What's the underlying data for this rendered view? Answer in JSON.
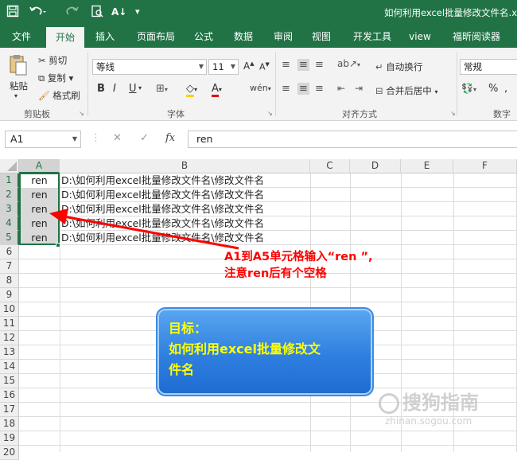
{
  "window": {
    "title": "如何利用excel批量修改文件名.x"
  },
  "ribbon_tabs": [
    "文件",
    "开始",
    "插入",
    "页面布局",
    "公式",
    "数据",
    "审阅",
    "视图",
    "开发工具",
    "view",
    "福昕阅读器"
  ],
  "active_tab": "开始",
  "clipboard": {
    "paste": "粘贴",
    "cut": "剪切",
    "copy": "复制",
    "format_painter": "格式刷",
    "group_label": "剪贴板"
  },
  "font": {
    "font_name": "等线",
    "font_size": "11",
    "group_label": "字体",
    "bold": "B",
    "italic": "I",
    "underline": "U"
  },
  "alignment": {
    "wrap_text": "自动换行",
    "merge_center": "合并后居中",
    "group_label": "对齐方式"
  },
  "number": {
    "format": "常规",
    "percent": "%",
    "group_label": "数字"
  },
  "formula_bar": {
    "name_box": "A1",
    "fx": "fx",
    "content": "ren"
  },
  "columns": [
    "A",
    "B",
    "C",
    "D",
    "E",
    "F"
  ],
  "rows": [
    "1",
    "2",
    "3",
    "4",
    "5",
    "6",
    "7",
    "8",
    "9",
    "10",
    "11",
    "12",
    "13",
    "14",
    "15",
    "16",
    "17",
    "18",
    "19",
    "20"
  ],
  "cells": [
    {
      "A": "ren",
      "B": "D:\\如何利用excel批量修改文件名\\修改文件名"
    },
    {
      "A": "ren",
      "B": "D:\\如何利用excel批量修改文件名\\修改文件名"
    },
    {
      "A": "ren",
      "B": "D:\\如何利用excel批量修改文件名\\修改文件名"
    },
    {
      "A": "ren",
      "B": "D:\\如何利用excel批量修改文件名\\修改文件名"
    },
    {
      "A": "ren",
      "B": "D:\\如何利用excel批量修改文件名\\修改文件名"
    }
  ],
  "annotation": {
    "line1": "A1到A5单元格输入“ren ”,",
    "line2": "注意ren后有个空格",
    "color": "#ff0000"
  },
  "goal_box": {
    "line1": "目标：",
    "line2": "如何利用excel批量修改文",
    "line3": "件名",
    "text_color": "#ffff00",
    "fill": "#2e7fe0"
  },
  "watermark": {
    "brand": "搜狗指南",
    "url": "zhinan.sogou.com"
  },
  "colors": {
    "excel_green": "#217346"
  }
}
